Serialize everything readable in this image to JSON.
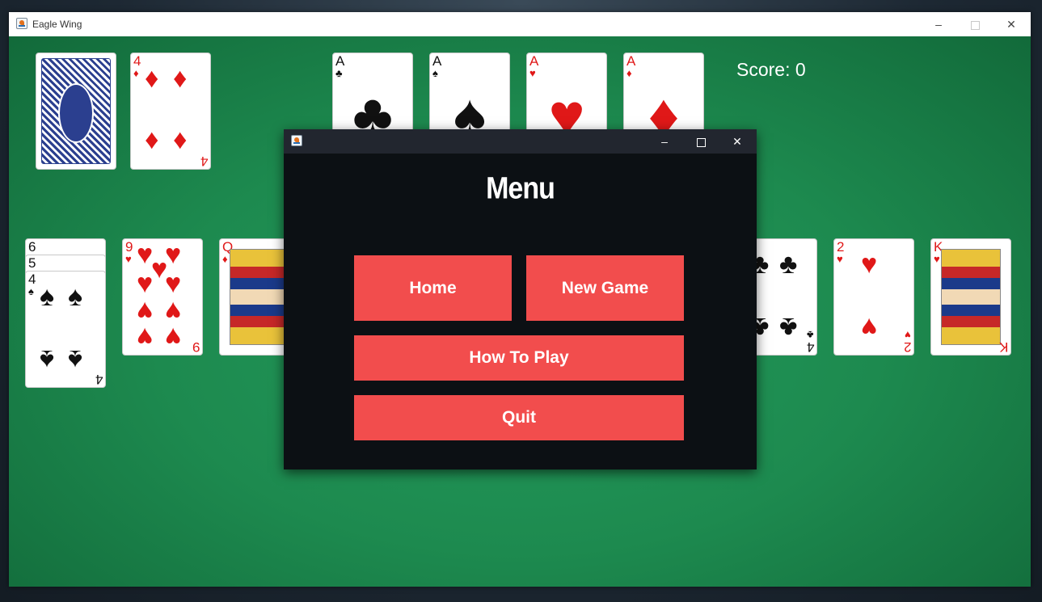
{
  "window": {
    "title": "Eagle Wing"
  },
  "game": {
    "score_label": "Score: 0",
    "waste": {
      "rank": "4",
      "suit": "♦"
    },
    "foundations": [
      {
        "rank": "A",
        "suit": "♣"
      },
      {
        "rank": "A",
        "suit": "♠"
      },
      {
        "rank": "A",
        "suit": "♥"
      },
      {
        "rank": "A",
        "suit": "♦"
      }
    ],
    "tableau": [
      {
        "ranks": [
          "6",
          "5",
          "4"
        ],
        "top_suit": "♠"
      },
      {
        "rank": "9",
        "suit": "♥"
      },
      {
        "rank": "Q",
        "suit": "♦"
      },
      {
        "rank": "4",
        "suit": "♣"
      },
      {
        "rank": "2",
        "suit": "♥"
      },
      {
        "rank": "K",
        "suit": "♥"
      }
    ]
  },
  "menu": {
    "title": "Menu",
    "home_label": "Home",
    "new_game_label": "New Game",
    "how_to_play_label": "How To Play",
    "quit_label": "Quit"
  },
  "icons": [
    "java-app-icon",
    "minimize-icon",
    "maximize-icon",
    "close-icon"
  ],
  "colors": {
    "felt": "#1d8a4f",
    "button": "#f24d4d",
    "dialog_bg": "#0c1014"
  }
}
